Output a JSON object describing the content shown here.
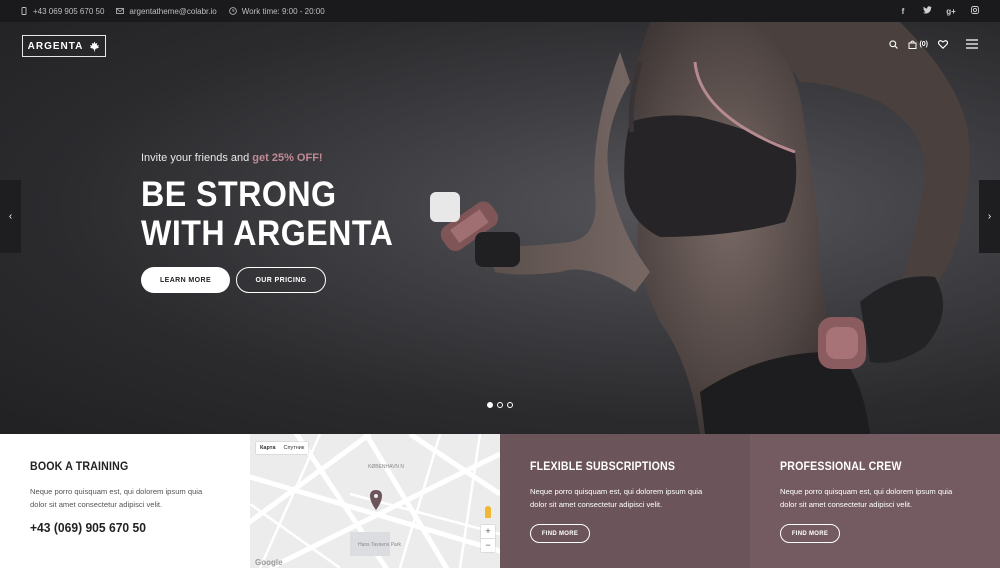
{
  "topbar": {
    "phone": "+43 069 905 670 50",
    "email": "argentatheme@colabr.io",
    "worktime": "Work time: 9:00 - 20:00",
    "social": [
      "f",
      "t",
      "g+",
      "ig"
    ]
  },
  "header": {
    "logo_text": "ARGENTA",
    "cart_count": "(0)"
  },
  "hero": {
    "invite_prefix": "Invite your friends and",
    "invite_highlight": "get 25% OFF!",
    "headline_line1": "BE STRONG",
    "headline_line2": "WITH ARGENTA",
    "btn_learn": "LEARN MORE",
    "btn_pricing": "OUR PRICING",
    "prev_arrow": "‹",
    "next_arrow": "›",
    "slide_count": 3,
    "active_slide": 1
  },
  "sections": {
    "book": {
      "title": "BOOK A TRAINING",
      "text": "Neque porro quisquam est, qui dolorem ipsum quia dolor sit amet consectetur adipisci velit.",
      "phone": "+43 (069) 905 670 50"
    },
    "map": {
      "tab_map": "Карта",
      "tab_sat": "Спутник",
      "zoom_in": "+",
      "zoom_out": "−",
      "labels": [
        "KØBENHAVN N",
        "Hans Tavsens Park",
        "Google"
      ]
    },
    "subscriptions": {
      "title": "FLEXIBLE SUBSCRIPTIONS",
      "text": "Neque porro quisquam est, qui dolorem ipsum quia dolor sit amet consectetur adipisci velit.",
      "button": "FIND MORE"
    },
    "crew": {
      "title": "PROFESSIONAL CREW",
      "text": "Neque porro quisquam est, qui dolorem ipsum quia dolor sit amet consectetur adipisci velit.",
      "button": "FIND MORE"
    }
  },
  "colors": {
    "accent": "#c08a96",
    "plum": "#6b555b",
    "plum_light": "#735b61",
    "topbar": "#1a1a1c"
  }
}
